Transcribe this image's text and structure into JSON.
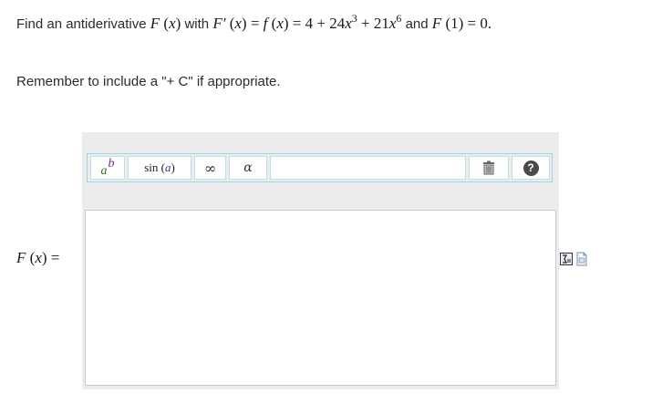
{
  "question": {
    "intro": "Find an antiderivative",
    "fn": "F",
    "x": "x",
    "with_word": "with",
    "fprime": "F′",
    "equals": "=",
    "f": "f",
    "const": "4",
    "plus": "+",
    "coef1": "24",
    "exp1": "3",
    "coef2": "21",
    "exp2": "6",
    "and_word": "and",
    "cond_arg": "1",
    "cond_val": "0."
  },
  "reminder": "Remember to include a \"+ C\" if appropriate.",
  "answer_label": {
    "fn": "F",
    "x": "x",
    "equals": "="
  },
  "toolbar": {
    "power_base": "a",
    "power_exp": "b",
    "sin_fn": "sin",
    "sin_arg": "a",
    "infinity": "∞",
    "alpha": "α",
    "help": "?"
  },
  "answer_value": "",
  "icons": [
    "power-icon",
    "sin-icon",
    "infinity-icon",
    "alpha-icon",
    "trash-icon",
    "help-icon",
    "equation-editor-icon",
    "preview-icon"
  ],
  "colors": {
    "toolbar_border": "#9cd7e4",
    "frame_bg": "#ececec"
  }
}
